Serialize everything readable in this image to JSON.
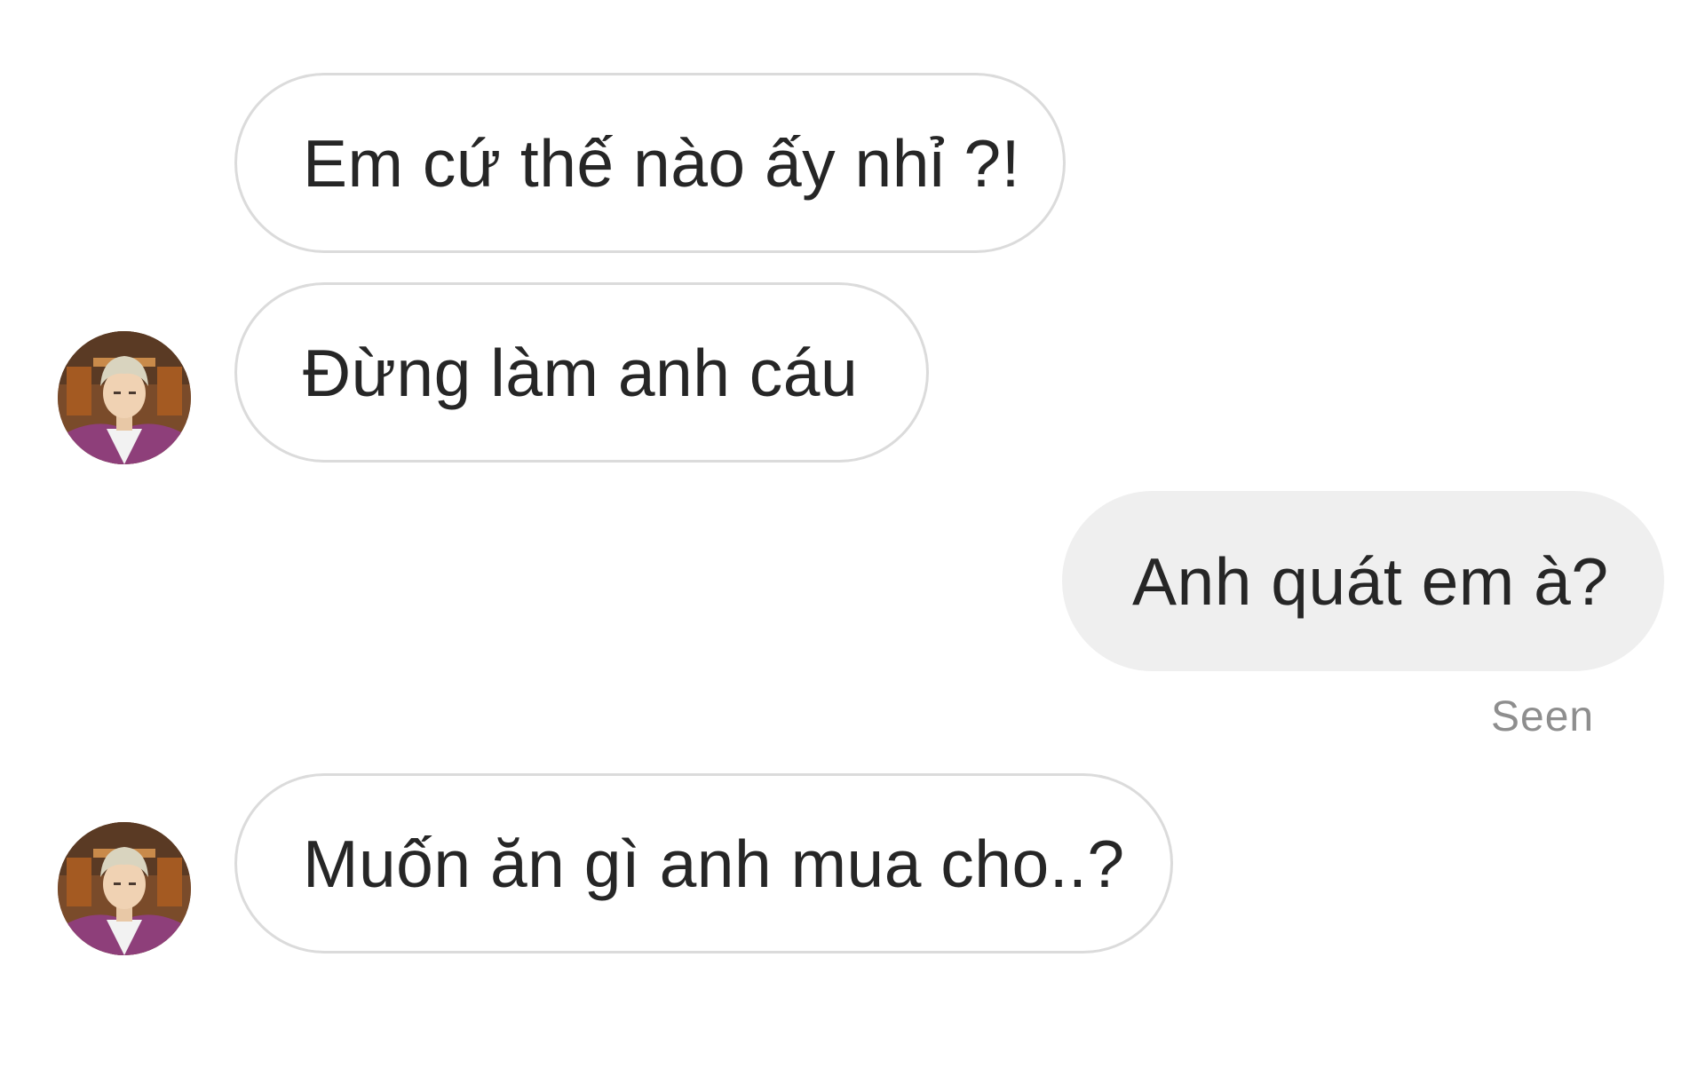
{
  "thread": {
    "messages": [
      {
        "sender": "other",
        "text": "Em cứ thế nào ấy nhỉ ?!",
        "show_avatar": false
      },
      {
        "sender": "other",
        "text": "Đừng làm anh cáu",
        "show_avatar": true
      },
      {
        "sender": "me",
        "text": "Anh quát em à?"
      },
      {
        "sender": "other",
        "text": "Muốn ăn gì anh mua cho..?",
        "show_avatar": true
      }
    ],
    "seen_label": "Seen"
  },
  "colors": {
    "incoming_border": "#dbdbdb",
    "outgoing_bg": "#efefef",
    "text": "#262626",
    "muted": "#8e8e8e"
  },
  "icons": {
    "avatar": "profile-avatar-anime-character"
  }
}
